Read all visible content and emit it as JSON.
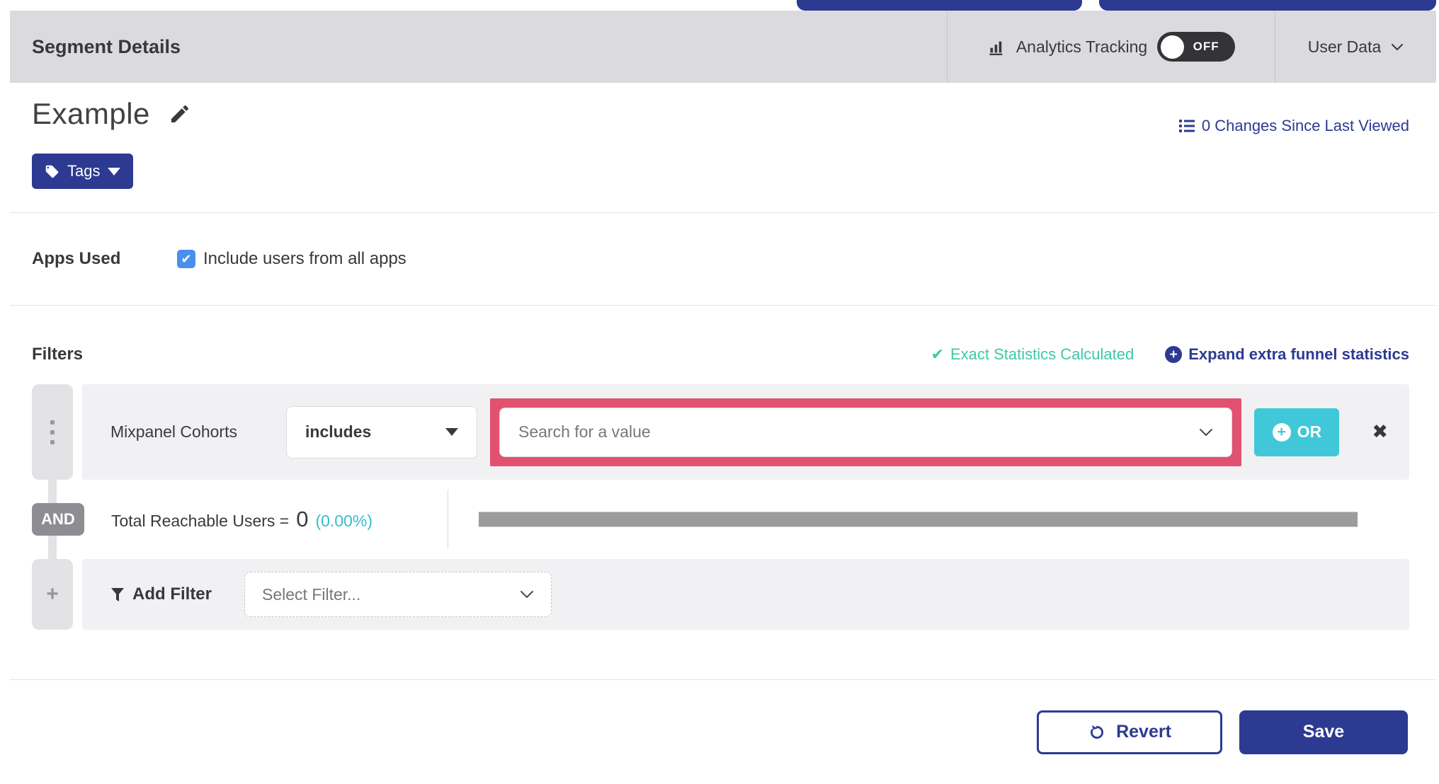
{
  "header": {
    "title": "Segment Details",
    "analytics_label": "Analytics Tracking",
    "toggle_state": "OFF",
    "user_data_label": "User Data"
  },
  "segment": {
    "name": "Example",
    "tags_label": "Tags",
    "changes_link": "0 Changes Since Last Viewed"
  },
  "apps": {
    "label": "Apps Used",
    "checkbox_label": "Include users from all apps",
    "checked": true
  },
  "filters": {
    "title": "Filters",
    "exact_stats": "Exact Statistics Calculated",
    "expand_link": "Expand extra funnel statistics",
    "row": {
      "name": "Mixpanel Cohorts",
      "operator": "includes",
      "value_placeholder": "Search for a value",
      "or_label": "OR"
    },
    "and_label": "AND",
    "reachable": {
      "label": "Total Reachable Users =",
      "value": "0",
      "percent": "(0.00%)"
    },
    "add_filter": {
      "label": "Add Filter",
      "placeholder": "Select Filter..."
    }
  },
  "footer": {
    "revert_label": "Revert",
    "save_label": "Save"
  },
  "icons": {
    "check": "✔",
    "close": "✖",
    "plus": "+"
  },
  "colors": {
    "brand_blue": "#2c3a92",
    "success_teal": "#3fc9a4",
    "percent_cyan": "#35bdd1",
    "or_teal": "#40c8d9",
    "highlight_pink": "#e2516f",
    "checkbox_blue": "#4a8fee",
    "header_gray": "#dbdbdf"
  }
}
